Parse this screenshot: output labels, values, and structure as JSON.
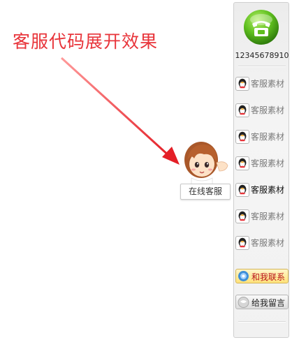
{
  "caption": "客服代码展开效果",
  "avatar": {
    "label": "在线客服"
  },
  "panel": {
    "phone_number": "12345678910",
    "service_items": [
      {
        "label": "客服素材",
        "active": false
      },
      {
        "label": "客服素材",
        "active": false
      },
      {
        "label": "客服素材",
        "active": false
      },
      {
        "label": "客服素材",
        "active": false
      },
      {
        "label": "客服素材",
        "active": true
      },
      {
        "label": "客服素材",
        "active": false
      },
      {
        "label": "客服素材",
        "active": false
      }
    ],
    "contact_button": "和我联系",
    "message_button": "给我留言"
  },
  "colors": {
    "caption": "#e8343a",
    "phone_icon": "#5fbf1f",
    "contact_text": "#b8131b"
  }
}
